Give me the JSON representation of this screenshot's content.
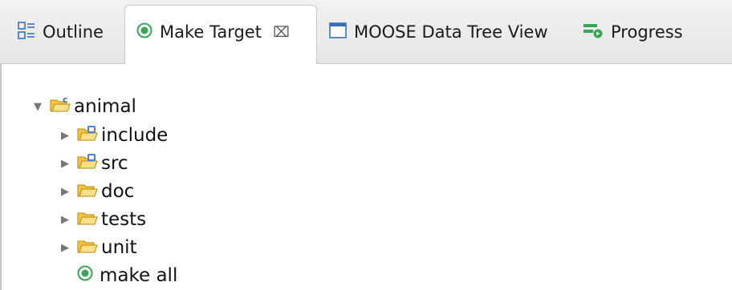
{
  "tabs": [
    {
      "label": "Outline",
      "icon": "outline-icon"
    },
    {
      "label": "Make Target",
      "icon": "make-target-icon",
      "active": true,
      "close_glyph": "⌧"
    },
    {
      "label": "MOOSE Data Tree View",
      "icon": "window-icon"
    },
    {
      "label": "Progress",
      "icon": "progress-icon"
    }
  ],
  "tree": {
    "root": {
      "label": "animal",
      "icon": "c-project-folder-icon",
      "expanded": true
    },
    "children": [
      {
        "label": "include",
        "icon": "source-folder-icon",
        "expandable": true
      },
      {
        "label": "src",
        "icon": "source-folder-icon",
        "expandable": true
      },
      {
        "label": "doc",
        "icon": "folder-icon",
        "expandable": true
      },
      {
        "label": "tests",
        "icon": "folder-icon",
        "expandable": true
      },
      {
        "label": "unit",
        "icon": "folder-icon",
        "expandable": true
      },
      {
        "label": "make all",
        "icon": "make-target-icon",
        "expandable": false
      }
    ]
  },
  "colors": {
    "tab_bar_bg": "#ebebeb",
    "folder_yellow": "#f5c542",
    "make_target_green": "#3aa655",
    "source_blue": "#4a7fd4"
  }
}
